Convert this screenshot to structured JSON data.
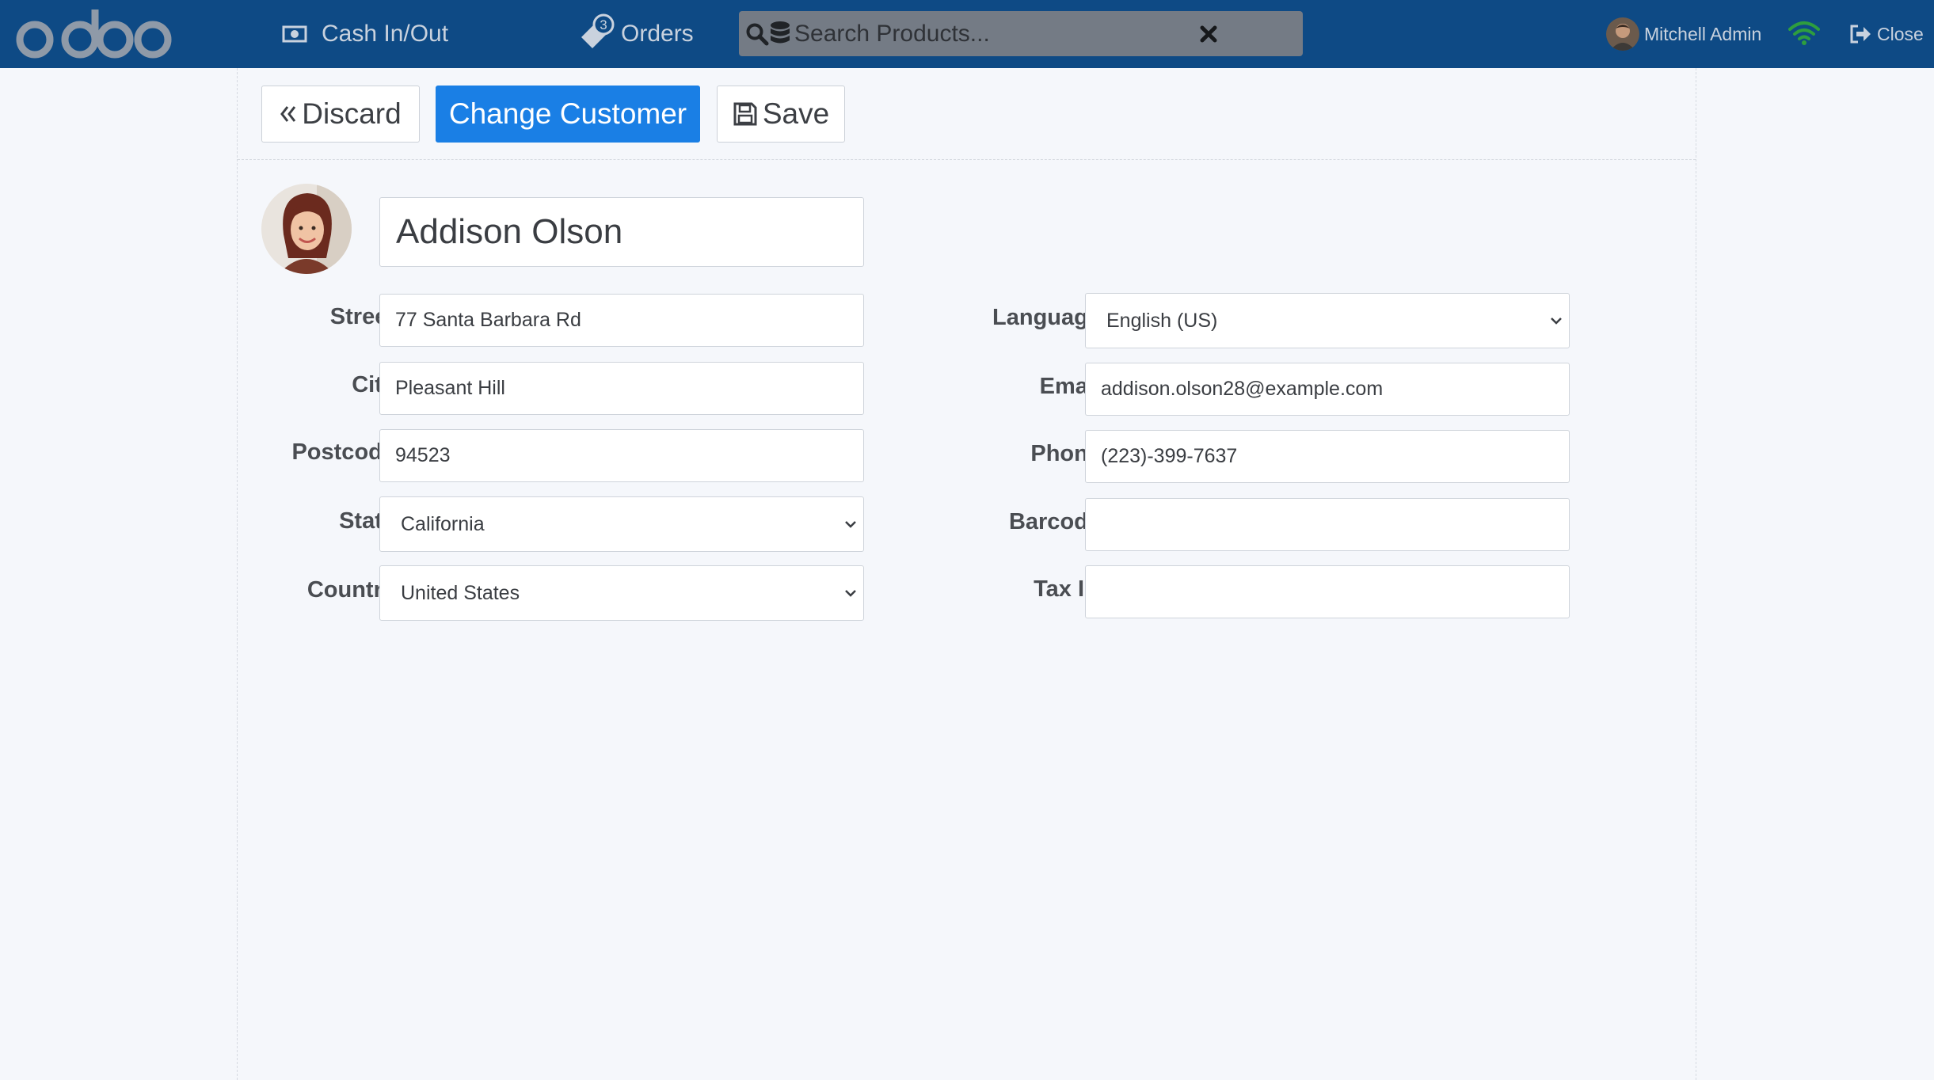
{
  "topbar": {
    "logo_text": "odoo",
    "cash_label": "Cash In/Out",
    "orders_label": "Orders",
    "orders_count": "3",
    "search_placeholder": "Search Products...",
    "user_name": "Mitchell Admin",
    "close_label": "Close"
  },
  "actions": {
    "discard_label": "Discard",
    "change_customer_label": "Change Customer",
    "save_label": "Save"
  },
  "customer": {
    "name": "Addison Olson",
    "fields_left": [
      {
        "label": "Street",
        "value": "77 Santa Barbara Rd"
      },
      {
        "label": "City",
        "value": "Pleasant Hill"
      },
      {
        "label": "Postcode",
        "value": "94523"
      },
      {
        "label": "State",
        "value": "California"
      },
      {
        "label": "Country",
        "value": "United States"
      }
    ],
    "fields_right": [
      {
        "label": "Language",
        "value": "English (US)"
      },
      {
        "label": "Email",
        "value": "addison.olson28@example.com"
      },
      {
        "label": "Phone",
        "value": "(223)-399-7637"
      },
      {
        "label": "Barcode",
        "value": ""
      },
      {
        "label": "Tax ID",
        "value": ""
      }
    ]
  },
  "colors": {
    "topbar": "#0e4a85",
    "primary": "#1a7fe5",
    "background": "#f5f7fb",
    "wifi": "#2e9e3e"
  },
  "icons": {
    "cash": "money-icon",
    "orders": "tag-icon",
    "search": "search-icon",
    "database": "database-icon",
    "clear": "close-icon",
    "wifi": "wifi-icon",
    "close": "sign-out-icon",
    "discard": "double-chevron-left-icon",
    "save": "floppy-disk-icon",
    "select": "chevron-down-icon"
  }
}
